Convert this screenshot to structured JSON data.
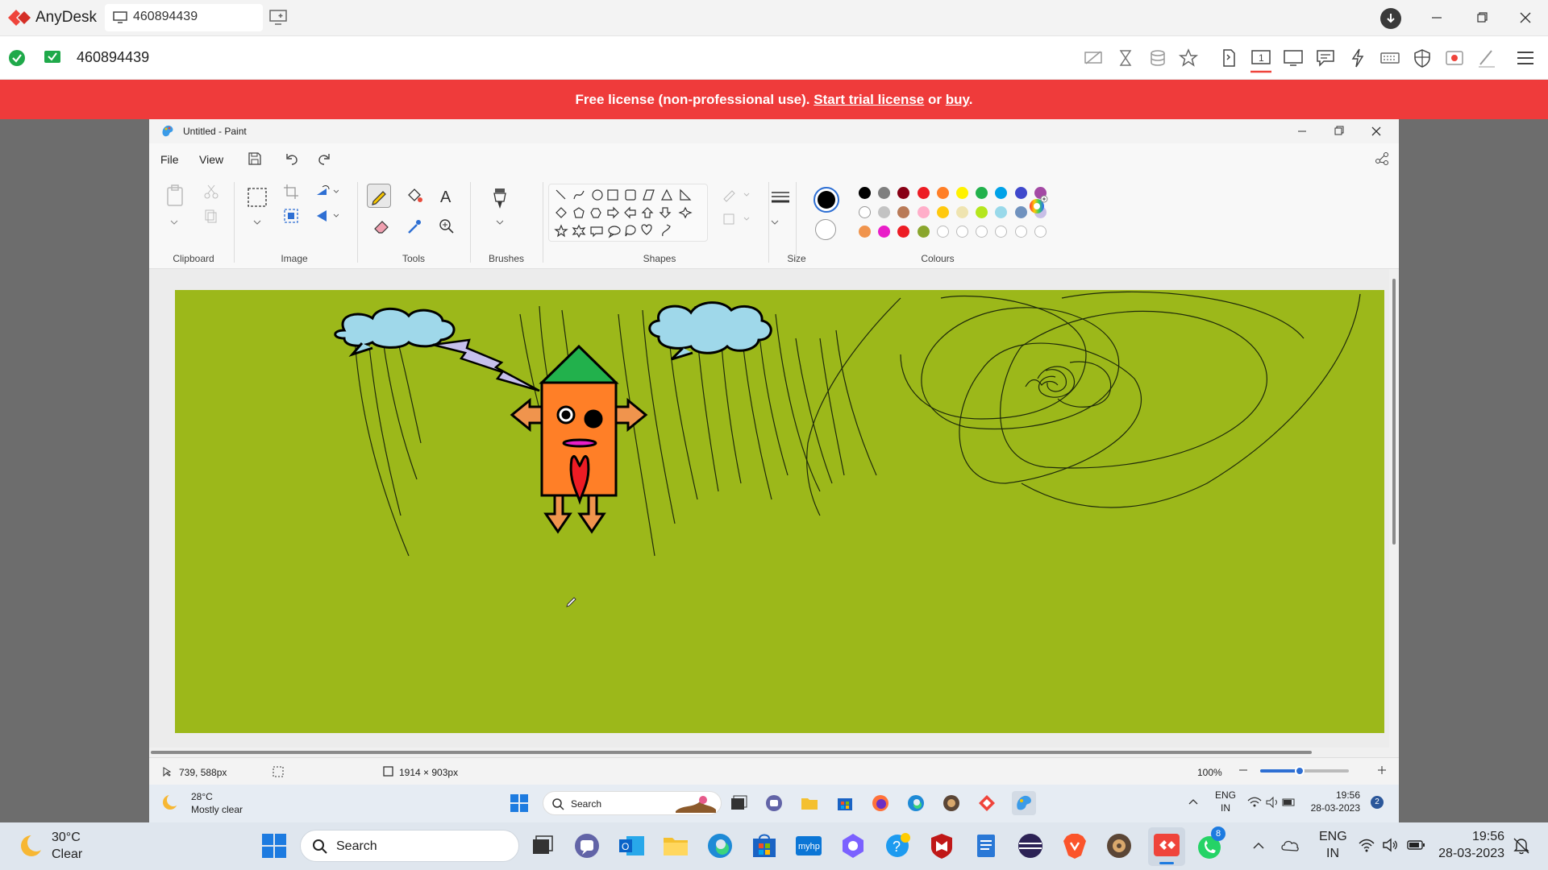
{
  "anydesk": {
    "app_name": "AnyDesk",
    "tab_label": "460894439",
    "address": "460894439",
    "colors": {
      "brand": "#ef443b",
      "banner": "#ef3b3b",
      "ok": "#1fa94a"
    }
  },
  "banner": {
    "prefix": "Free license (non-professional use).",
    "trial_link": "Start trial license",
    "middle": "or",
    "buy_link": "buy",
    "suffix": "."
  },
  "paint": {
    "title": "Untitled - Paint",
    "menu": {
      "file": "File",
      "view": "View"
    },
    "groups": {
      "clipboard": "Clipboard",
      "image": "Image",
      "tools": "Tools",
      "brushes": "Brushes",
      "shapes": "Shapes",
      "size": "Size",
      "colours": "Colours"
    },
    "palette": [
      "#000000",
      "#7f7f7f",
      "#880015",
      "#ed1c24",
      "#ff7f27",
      "#fff200",
      "#22b14c",
      "#00a2e8",
      "#3f48cc",
      "#a349a4",
      "#ffffff",
      "#c3c3c3",
      "#b97a57",
      "#ffaec9",
      "#ffc90e",
      "#efe4b0",
      "#b5e61d",
      "#99d9ea",
      "#7092be",
      "#c8bfe7",
      "#f0944d",
      "#e91ec8",
      "#ed1c24",
      "#8aa62d",
      "",
      "",
      "",
      "",
      "",
      ""
    ],
    "canvas_color": "#9cb81a",
    "status": {
      "cursor_pos": "739, 588px",
      "canvas_size": "1914 × 903px",
      "zoom": "100%"
    }
  },
  "remote_taskbar": {
    "weather_temp": "28°C",
    "weather_desc": "Mostly clear",
    "search": "Search",
    "lang1": "ENG",
    "lang2": "IN",
    "time": "19:56",
    "date": "28-03-2023",
    "badge": "2"
  },
  "taskbar": {
    "weather_temp": "30°C",
    "weather_desc": "Clear",
    "search": "Search",
    "lang1": "ENG",
    "lang2": "IN",
    "time": "19:56",
    "date": "28-03-2023",
    "whatsapp_badge": "8"
  }
}
